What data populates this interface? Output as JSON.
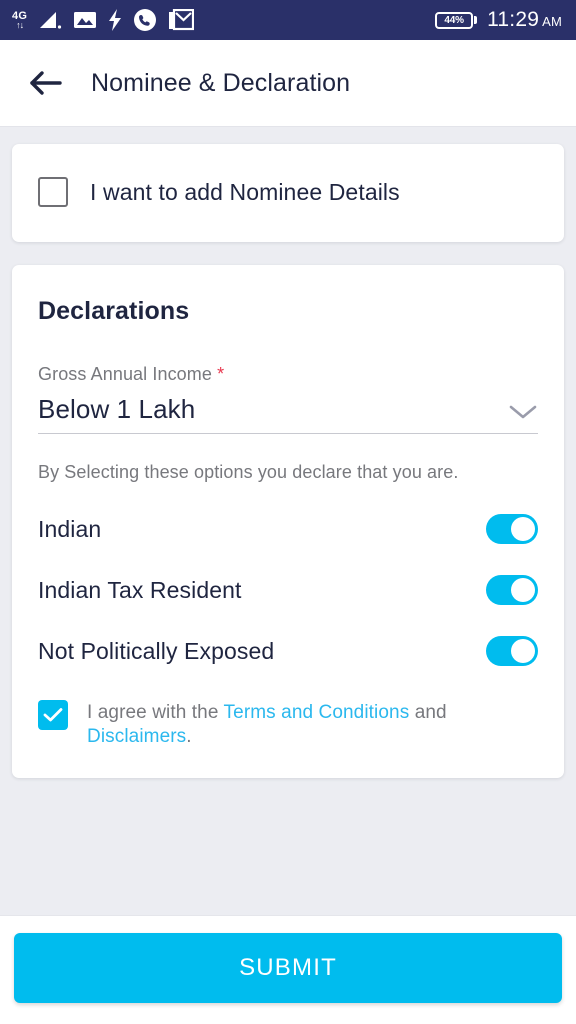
{
  "status_bar": {
    "network_label": "4G",
    "network_arrows": "↑↓",
    "battery_text": "44%",
    "time": "11:29",
    "meridiem": "AM",
    "icons": [
      "signal-bars-icon",
      "photo-icon",
      "flash-icon",
      "phone-call-icon",
      "gmail-icon"
    ],
    "background_color": "#2a3069"
  },
  "app_bar": {
    "back_label": "back",
    "title": "Nominee & Declaration"
  },
  "nominee": {
    "checkbox_label": "I want to add Nominee Details",
    "checked": false
  },
  "declarations": {
    "title": "Declarations",
    "income": {
      "label": "Gross Annual Income",
      "required_mark": "*",
      "value": "Below 1 Lakh"
    },
    "hint": "By Selecting these options you declare that you are.",
    "toggles": [
      {
        "label": "Indian",
        "on": true
      },
      {
        "label": "Indian Tax Resident",
        "on": true
      },
      {
        "label": "Not Politically Exposed",
        "on": true
      }
    ],
    "agree": {
      "checked": true,
      "prefix": "I agree with the ",
      "link1": "Terms and Conditions",
      "middle": " and ",
      "link2": "Disclaimers",
      "suffix": "."
    }
  },
  "footer": {
    "submit_label": "SUBMIT"
  },
  "theme": {
    "accent": "#00bcee",
    "link": "#2bb8ee",
    "required": "#e8384f",
    "page_bg": "#ecedf2",
    "text_dark": "#1f2540",
    "text_muted": "#77787d"
  }
}
